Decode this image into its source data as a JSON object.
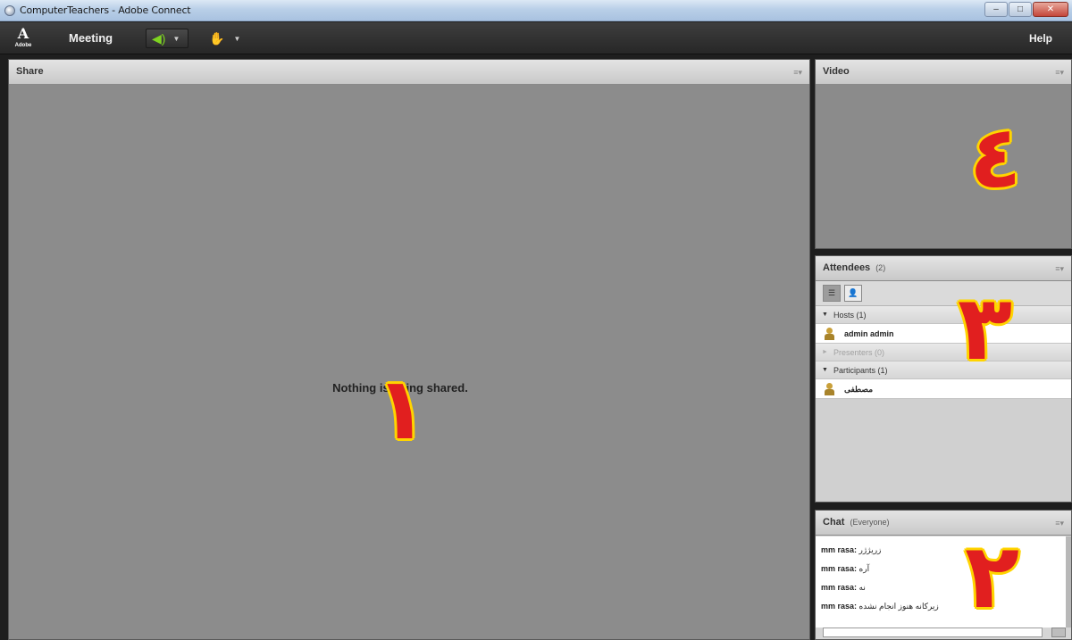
{
  "window": {
    "title": "ComputerTeachers - Adobe Connect",
    "buttons": {
      "minimize": "–",
      "maximize": "□",
      "close": "✕"
    }
  },
  "menubar": {
    "logo_text": "Adobe",
    "meeting_label": "Meeting",
    "help_label": "Help"
  },
  "share_pod": {
    "title": "Share",
    "empty_message": "Nothing is being shared."
  },
  "video_pod": {
    "title": "Video"
  },
  "attendees_pod": {
    "title": "Attendees",
    "count": "(2)",
    "groups": [
      {
        "label": "Hosts (1)",
        "members": [
          "admin admin"
        ]
      },
      {
        "label": "Presenters (0)",
        "members": []
      },
      {
        "label": "Participants (1)",
        "members": [
          "مصطفی"
        ]
      }
    ]
  },
  "chat_pod": {
    "title": "Chat",
    "scope": "(Everyone)",
    "messages": [
      {
        "sender": "mm rasa:",
        "text": "زریژژر"
      },
      {
        "sender": "mm rasa:",
        "text": "آره"
      },
      {
        "sender": "mm rasa:",
        "text": "نه"
      },
      {
        "sender": "mm rasa:",
        "text": "زیرکانه هنوز انجام نشده"
      }
    ]
  },
  "annotations": {
    "share": "١",
    "chat": "٢",
    "attendees": "٣",
    "video": "٤",
    "color": "#e11f1f",
    "outline": "#ffd400"
  },
  "icons": {
    "audio": "speaker-icon",
    "status": "raise-hand-icon",
    "user": "user-icon",
    "menu": "pod-menu-icon"
  }
}
